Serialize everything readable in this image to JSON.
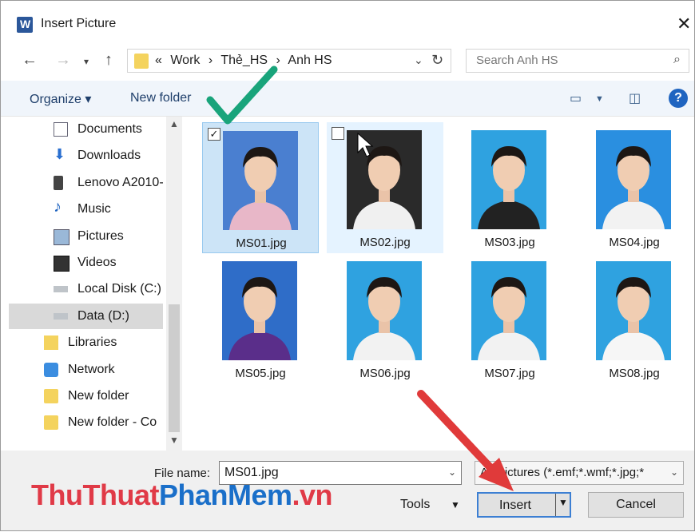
{
  "window": {
    "title": "Insert Picture",
    "close_glyph": "✕"
  },
  "address": {
    "crumbs": [
      "«",
      "Work",
      "›",
      "Thẻ_HS",
      "›",
      "Anh HS"
    ]
  },
  "search": {
    "placeholder": "Search Anh HS"
  },
  "toolbar": {
    "organize_label": "Organize ▾",
    "new_folder_label": "New folder",
    "help_label": "?"
  },
  "nav": {
    "items": [
      {
        "label": "Documents",
        "icon": "documents-icon"
      },
      {
        "label": "Downloads",
        "icon": "downloads-icon"
      },
      {
        "label": "Lenovo A2010-",
        "icon": "phone-icon"
      },
      {
        "label": "Music",
        "icon": "music-icon"
      },
      {
        "label": "Pictures",
        "icon": "pictures-icon"
      },
      {
        "label": "Videos",
        "icon": "videos-icon"
      },
      {
        "label": "Local Disk (C:)",
        "icon": "disk-icon"
      },
      {
        "label": "Data (D:)",
        "icon": "disk-icon",
        "selected": true
      },
      {
        "label": "Libraries",
        "icon": "libraries-icon"
      },
      {
        "label": "Network",
        "icon": "network-icon"
      },
      {
        "label": "New folder",
        "icon": "folder-icon"
      },
      {
        "label": "New folder - Co",
        "icon": "folder-icon"
      }
    ]
  },
  "files": [
    {
      "name": "MS01.jpg",
      "selected": true,
      "checked": true,
      "bg": "#4a7fd0",
      "shirt": "#e8b7c8"
    },
    {
      "name": "MS02.jpg",
      "selected": false,
      "checked": false,
      "hover": true,
      "bg": "#2a2a2a",
      "shirt": "#f0f0f0"
    },
    {
      "name": "MS03.jpg",
      "bg": "#2fa2e0",
      "shirt": "#222222"
    },
    {
      "name": "MS04.jpg",
      "bg": "#2a8fe0",
      "shirt": "#f2f2f2"
    },
    {
      "name": "MS05.jpg",
      "bg": "#2f6dc8",
      "shirt": "#5a2e8a"
    },
    {
      "name": "MS06.jpg",
      "bg": "#2fa2e0",
      "shirt": "#f2f2f2"
    },
    {
      "name": "MS07.jpg",
      "bg": "#2fa2e0",
      "shirt": "#f2f2f2"
    },
    {
      "name": "MS08.jpg",
      "bg": "#2fa2e0",
      "shirt": "#f6f6f6"
    }
  ],
  "footer": {
    "file_name_label": "File name:",
    "file_name_value": "MS01.jpg",
    "file_type_value": "All Pictures (*.emf;*.wmf;*.jpg;*",
    "tools_label": "Tools",
    "insert_label": "Insert",
    "cancel_label": "Cancel"
  },
  "watermark": {
    "part1": "ThuThuat",
    "part2": "PhanMem",
    "part3": ".vn"
  },
  "colors": {
    "accent": "#1f64c0",
    "selection": "#cce4f7",
    "checkmark": "#19a47b",
    "arrow": "#e03a3a"
  }
}
